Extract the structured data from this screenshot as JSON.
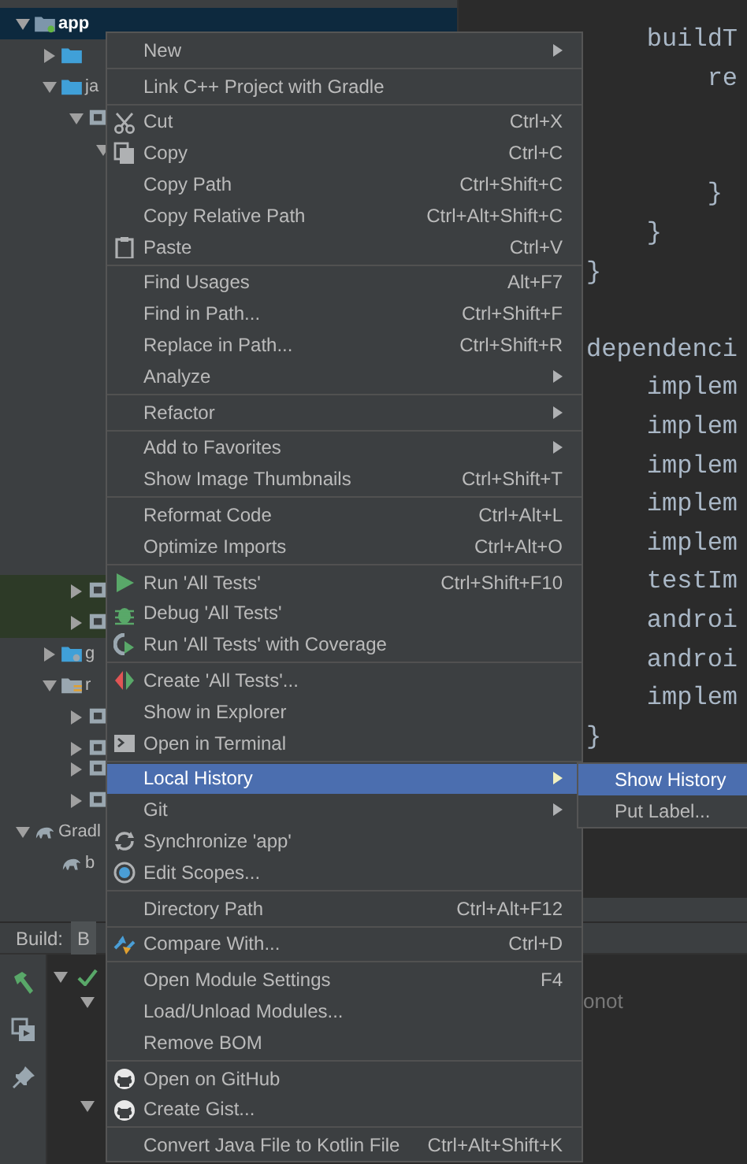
{
  "project_tree": [
    {
      "label": "app",
      "kind": "module",
      "expanded": true,
      "selected": true,
      "highlighted": false,
      "children": [
        {
          "kind": "source",
          "expanded": false,
          "selected": false,
          "highlighted": false
        },
        {
          "label": "ja",
          "kind": "source",
          "expanded": true,
          "selected": false,
          "highlighted": false,
          "children": [
            {
              "kind": "package",
              "expanded": true,
              "selected": false,
              "highlighted": false,
              "children": [
                {
                  "expanded": true,
                  "selected": false,
                  "highlighted": false
                }
              ]
            },
            {
              "kind": "package",
              "expanded": false,
              "selected": false,
              "highlighted": true
            },
            {
              "kind": "package",
              "expanded": false,
              "selected": false,
              "highlighted": true
            }
          ]
        },
        {
          "label": "g",
          "kind": "generated",
          "expanded": false,
          "selected": false,
          "highlighted": false
        },
        {
          "label": "r",
          "kind": "resources",
          "expanded": true,
          "selected": false,
          "highlighted": false,
          "children": [
            {
              "kind": "package",
              "expanded": false,
              "selected": false,
              "highlighted": false
            },
            {
              "kind": "package",
              "expanded": false,
              "selected": false,
              "highlighted": false
            },
            {
              "kind": "package",
              "expanded": false,
              "selected": false,
              "highlighted": false
            },
            {
              "kind": "package",
              "expanded": false,
              "selected": false,
              "highlighted": false
            }
          ]
        }
      ]
    },
    {
      "label": "Gradl",
      "kind": "gradle",
      "expanded": true,
      "selected": false,
      "highlighted": false,
      "children": [
        {
          "label": "b",
          "kind": "gradle-file",
          "selected": false,
          "highlighted": false
        }
      ]
    }
  ],
  "editor": {
    "lines": [
      {
        "kind": "code",
        "text": "    buildT"
      },
      {
        "kind": "code",
        "text": "        re"
      },
      {
        "kind": "blank"
      },
      {
        "kind": "blank"
      },
      {
        "kind": "code",
        "text": "        }"
      },
      {
        "kind": "code",
        "text": "    }"
      },
      {
        "kind": "code",
        "text": "}"
      },
      {
        "kind": "blank"
      },
      {
        "kind": "code",
        "text": "dependenci"
      },
      {
        "kind": "code",
        "text": "    implem"
      },
      {
        "kind": "code",
        "text": "    implem"
      },
      {
        "kind": "code",
        "text": "    implem"
      },
      {
        "kind": "code",
        "text": "    implem"
      },
      {
        "kind": "code",
        "text": "    implem"
      },
      {
        "kind": "code",
        "text": "    testIm"
      },
      {
        "kind": "code",
        "text": "    androi"
      },
      {
        "kind": "code",
        "text": "    androi"
      },
      {
        "kind": "code",
        "text": "    implem"
      },
      {
        "kind": "code",
        "text": "}"
      }
    ]
  },
  "build_panel": {
    "label": "Build:",
    "tabs": [
      {
        "label": "B",
        "selected": true
      }
    ],
    "tree": [
      {
        "expanded": true,
        "succeeded": true,
        "children": [
          {
            "expanded": true
          },
          {
            "expanded": true
          }
        ]
      }
    ],
    "output_text": "onot"
  },
  "context_menu": {
    "groups": [
      [
        {
          "label": "New",
          "has_submenu": true,
          "selected": false
        }
      ],
      [
        {
          "label": "Link C++ Project with Gradle",
          "has_submenu": false,
          "selected": false
        }
      ],
      [
        {
          "label": "Cut",
          "shortcut": "Ctrl+X",
          "has_submenu": false,
          "selected": false
        },
        {
          "label": "Copy",
          "shortcut": "Ctrl+C",
          "has_submenu": false,
          "selected": false
        },
        {
          "label": "Copy Path",
          "shortcut": "Ctrl+Shift+C",
          "has_submenu": false,
          "selected": false
        },
        {
          "label": "Copy Relative Path",
          "shortcut": "Ctrl+Alt+Shift+C",
          "has_submenu": false,
          "selected": false
        },
        {
          "label": "Paste",
          "shortcut": "Ctrl+V",
          "has_submenu": false,
          "selected": false
        }
      ],
      [
        {
          "label": "Find Usages",
          "shortcut": "Alt+F7",
          "has_submenu": false,
          "selected": false
        },
        {
          "label": "Find in Path...",
          "shortcut": "Ctrl+Shift+F",
          "has_submenu": false,
          "selected": false
        },
        {
          "label": "Replace in Path...",
          "shortcut": "Ctrl+Shift+R",
          "has_submenu": false,
          "selected": false
        },
        {
          "label": "Analyze",
          "has_submenu": true,
          "selected": false
        }
      ],
      [
        {
          "label": "Refactor",
          "has_submenu": true,
          "selected": false
        }
      ],
      [
        {
          "label": "Add to Favorites",
          "has_submenu": true,
          "selected": false
        },
        {
          "label": "Show Image Thumbnails",
          "shortcut": "Ctrl+Shift+T",
          "has_submenu": false,
          "selected": false
        }
      ],
      [
        {
          "label": "Reformat Code",
          "shortcut": "Ctrl+Alt+L",
          "has_submenu": false,
          "selected": false
        },
        {
          "label": "Optimize Imports",
          "shortcut": "Ctrl+Alt+O",
          "has_submenu": false,
          "selected": false
        }
      ],
      [
        {
          "label": "Run 'All Tests'",
          "shortcut": "Ctrl+Shift+F10",
          "has_submenu": false,
          "selected": false
        },
        {
          "label": "Debug 'All Tests'",
          "has_submenu": false,
          "selected": false
        },
        {
          "label": "Run 'All Tests' with Coverage",
          "has_submenu": false,
          "selected": false
        }
      ],
      [
        {
          "label": "Create 'All Tests'...",
          "has_submenu": false,
          "selected": false
        },
        {
          "label": "Show in Explorer",
          "has_submenu": false,
          "selected": false
        },
        {
          "label": "Open in Terminal",
          "has_submenu": false,
          "selected": false
        }
      ],
      [
        {
          "label": "Local History",
          "has_submenu": true,
          "selected": true
        },
        {
          "label": "Git",
          "has_submenu": true,
          "selected": false
        },
        {
          "label": "Synchronize 'app'",
          "has_submenu": false,
          "selected": false
        },
        {
          "label": "Edit Scopes...",
          "has_submenu": false,
          "selected": false
        }
      ],
      [
        {
          "label": "Directory Path",
          "shortcut": "Ctrl+Alt+F12",
          "has_submenu": false,
          "selected": false
        }
      ],
      [
        {
          "label": "Compare With...",
          "shortcut": "Ctrl+D",
          "has_submenu": false,
          "selected": false
        }
      ],
      [
        {
          "label": "Open Module Settings",
          "shortcut": "F4",
          "has_submenu": false,
          "selected": false
        },
        {
          "label": "Load/Unload Modules...",
          "has_submenu": false,
          "selected": false
        },
        {
          "label": "Remove BOM",
          "has_submenu": false,
          "selected": false
        }
      ],
      [
        {
          "label": "Open on GitHub",
          "has_submenu": false,
          "selected": false
        },
        {
          "label": "Create Gist...",
          "has_submenu": false,
          "selected": false
        }
      ],
      [
        {
          "label": "Convert Java File to Kotlin File",
          "shortcut": "Ctrl+Alt+Shift+K",
          "has_submenu": false,
          "selected": false
        }
      ]
    ]
  },
  "submenu": {
    "items": [
      {
        "label": "Show History",
        "selected": true
      },
      {
        "label": "Put Label...",
        "selected": false
      }
    ]
  }
}
